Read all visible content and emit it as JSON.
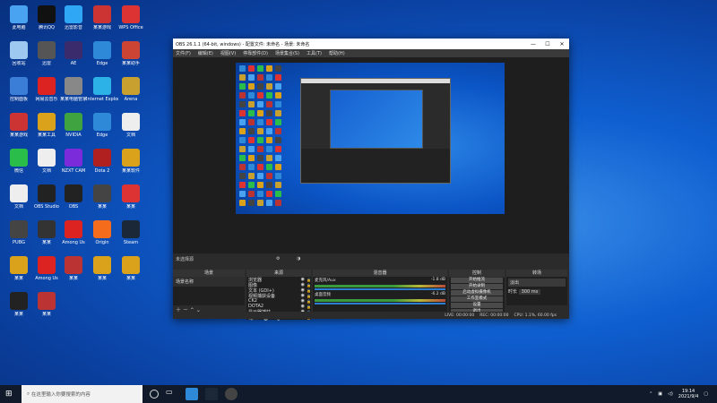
{
  "desktop": {
    "icons": [
      {
        "label": "此电脑",
        "color": "#4aa3f0"
      },
      {
        "label": "腾讯QQ",
        "color": "#111"
      },
      {
        "label": "迅雷影音",
        "color": "#2fa7f5"
      },
      {
        "label": "某某游戏",
        "color": "#c33"
      },
      {
        "label": "WPS Office",
        "color": "#d33"
      },
      {
        "label": "回收站",
        "color": "#9ec8ef"
      },
      {
        "label": "迅雷",
        "color": "#555"
      },
      {
        "label": "AE",
        "color": "#3a2c6c"
      },
      {
        "label": "Edge",
        "color": "#2e8ad8"
      },
      {
        "label": "某某助手",
        "color": "#c43"
      },
      {
        "label": "控制面板",
        "color": "#3a7ed8"
      },
      {
        "label": "网易云音乐",
        "color": "#d22"
      },
      {
        "label": "某某电脑管家",
        "color": "#888"
      },
      {
        "label": "Internet Explorer",
        "color": "#2cb2e6"
      },
      {
        "label": "Arena",
        "color": "#c7a030"
      },
      {
        "label": "某某游戏",
        "color": "#c33"
      },
      {
        "label": "某某工具",
        "color": "#d9a21a"
      },
      {
        "label": "NVIDIA",
        "color": "#3fa33f"
      },
      {
        "label": "Edge",
        "color": "#2e8ad8"
      },
      {
        "label": "文档",
        "color": "#eee"
      },
      {
        "label": "微信",
        "color": "#2bbd4a"
      },
      {
        "label": "文档",
        "color": "#eee"
      },
      {
        "label": "NZXT CAM",
        "color": "#7b2bd9"
      },
      {
        "label": "Dota 2",
        "color": "#b02020"
      },
      {
        "label": "某某软件",
        "color": "#d9a21a"
      },
      {
        "label": "文档",
        "color": "#eee"
      },
      {
        "label": "OBS Studio",
        "color": "#222"
      },
      {
        "label": "OBS",
        "color": "#222"
      },
      {
        "label": "某某",
        "color": "#444"
      },
      {
        "label": "某某",
        "color": "#d33"
      },
      {
        "label": "PUBG",
        "color": "#444"
      },
      {
        "label": "某某",
        "color": "#333"
      },
      {
        "label": "Among Us",
        "color": "#d22"
      },
      {
        "label": "Origin",
        "color": "#f56c1d"
      },
      {
        "label": "Steam",
        "color": "#1b2838"
      },
      {
        "label": "某某",
        "color": "#d9a21a"
      },
      {
        "label": "Among Us",
        "color": "#d22"
      },
      {
        "label": "某某",
        "color": "#b33"
      },
      {
        "label": "某某",
        "color": "#d9a21a"
      },
      {
        "label": "某某",
        "color": "#d9a21a"
      },
      {
        "label": "某某",
        "color": "#222"
      },
      {
        "label": "某某",
        "color": "#b33"
      }
    ]
  },
  "obs": {
    "title": "OBS 26.1.1 (64-bit, windows) - 配置文件: 未命名 - 场景: 未命名",
    "menu": [
      "文件(F)",
      "编辑(E)",
      "视图(V)",
      "停靠部件(D)",
      "场景集合(S)",
      "工具(T)",
      "帮助(H)"
    ],
    "no_source": "未选择源",
    "docks": {
      "scenes": "场景",
      "sources": "来源",
      "mixer": "混音器",
      "transitions": "转场",
      "controls": "控制"
    },
    "scene_item": "场景名称",
    "sources": [
      "浏览器",
      "图像",
      "文本 (GDI+)",
      "视频捕获设备",
      "CK2",
      "DOTA2",
      "显示器捕获",
      "窗口"
    ],
    "mixer": [
      {
        "name": "麦克风/Aux",
        "db": "-1.8 dB"
      },
      {
        "name": "桌面音频",
        "db": "-6.2 dB"
      }
    ],
    "transition": {
      "name": "淡出",
      "label": "时长",
      "duration": "300 ms"
    },
    "controls": [
      "开始推流",
      "开始录制",
      "启动虚拟摄像机",
      "工作室模式",
      "设置",
      "退出"
    ],
    "status": [
      "LIVE: 00:00:00",
      "REC: 00:00:00",
      "CPU: 1.1%, 60.00 fps"
    ]
  },
  "taskbar": {
    "search_placeholder": "在这里输入你要搜索的内容",
    "time": "19:14",
    "date": "2021/9/4"
  }
}
